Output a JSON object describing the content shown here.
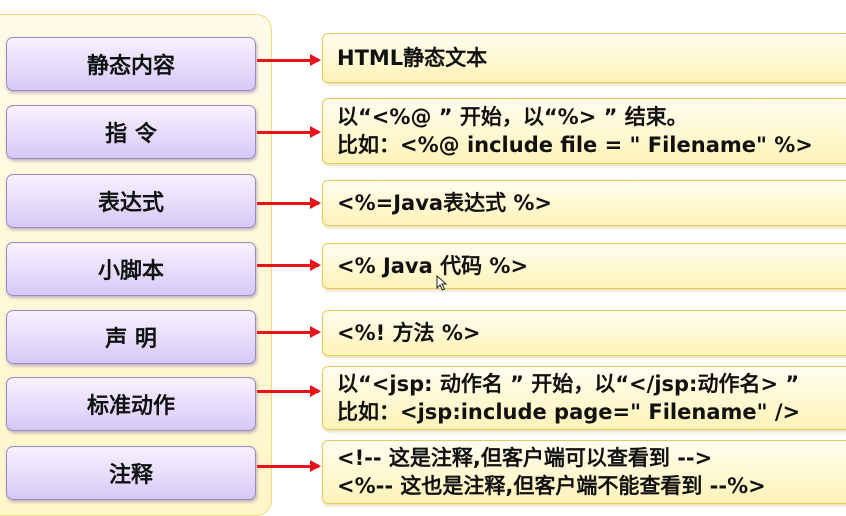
{
  "rows": [
    {
      "label": "静态内容",
      "lines": [
        "HTML静态文本"
      ]
    },
    {
      "label": "指 令",
      "lines": [
        "以“<%@ ” 开始，以“%> ” 结束。",
        "比如：<%@ include file = \" Filename\" %>"
      ]
    },
    {
      "label": "表达式",
      "lines": [
        "<%=Java表达式 %>"
      ]
    },
    {
      "label": "小脚本",
      "lines": [
        "<% Java 代码 %>"
      ]
    },
    {
      "label": "声 明",
      "lines": [
        "<%! 方法 %>"
      ]
    },
    {
      "label": "标准动作",
      "lines": [
        "以“<jsp: 动作名 ” 开始，以“</jsp:动作名> ”",
        "比如：<jsp:include page=\" Filename\" />"
      ]
    },
    {
      "label": "注释",
      "lines": [
        "<!-- 这是注释,但客户端可以查看到 -->",
        "<%-- 这也是注释,但客户端不能查看到 --%>"
      ]
    }
  ],
  "colors": {
    "arrow": "#e8141a",
    "label_fill": "#e6dcfb",
    "code_fill": "#fff3b8"
  }
}
